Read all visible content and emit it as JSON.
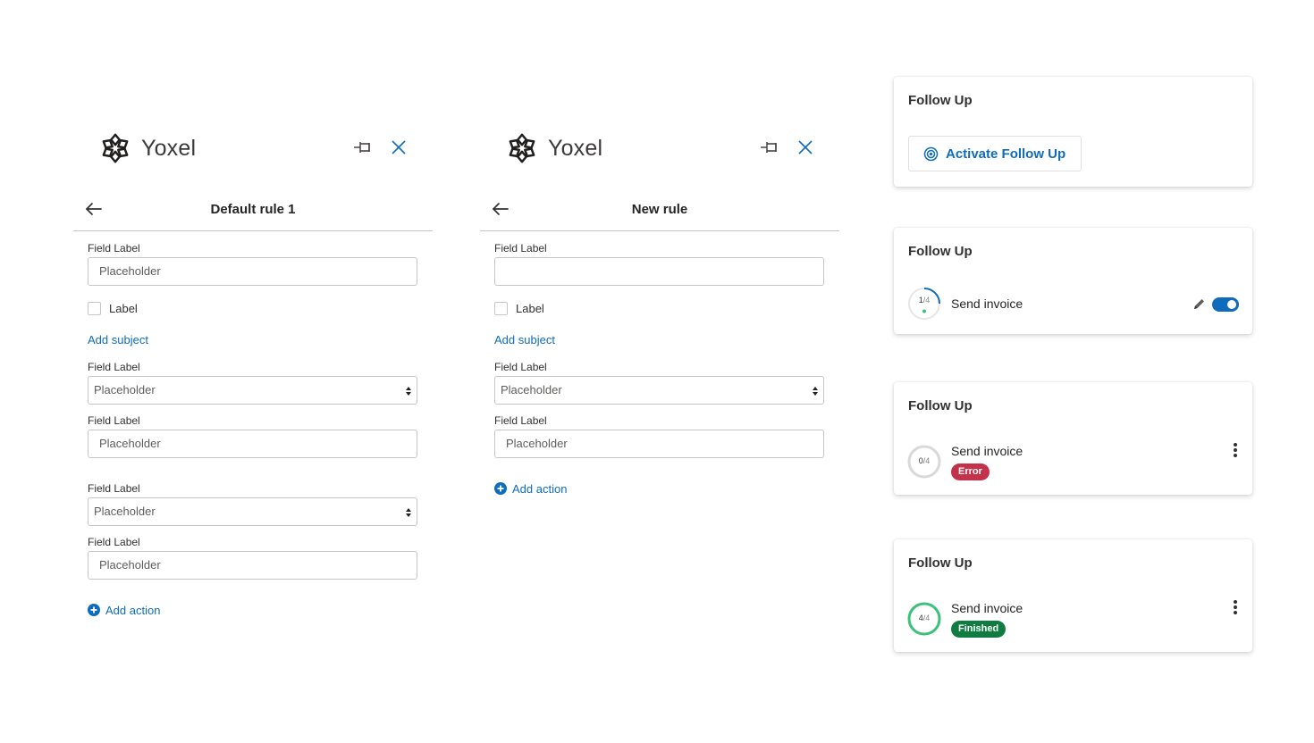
{
  "brand": {
    "name": "Yoxel",
    "logo_icon": "snowflake-logo-icon"
  },
  "rule_panels": [
    {
      "title": "Default rule 1",
      "pin_icon": "pin-icon",
      "close_icon": "close-icon",
      "back_icon": "arrow-left-icon",
      "field1": {
        "label": "Field Label",
        "placeholder": "Placeholder",
        "value": "Placeholder"
      },
      "checkbox": {
        "label": "Label",
        "checked": false
      },
      "add_subject": "Add subject",
      "select1": {
        "label": "Field Label",
        "value": "Placeholder"
      },
      "field2": {
        "label": "Field Label",
        "value": "Placeholder"
      },
      "select2": {
        "label": "Field Label",
        "value": "Placeholder"
      },
      "field3": {
        "label": "Field Label",
        "value": "Placeholder"
      },
      "add_action": "Add action"
    },
    {
      "title": "New rule",
      "pin_icon": "pin-icon",
      "close_icon": "close-icon",
      "back_icon": "arrow-left-icon",
      "field1": {
        "label": "Field Label",
        "value": ""
      },
      "checkbox": {
        "label": "Label",
        "checked": false
      },
      "add_subject": "Add subject",
      "select1": {
        "label": "Field Label",
        "value": "Placeholder"
      },
      "field2": {
        "label": "Field Label",
        "value": "Placeholder"
      },
      "add_action": "Add action"
    }
  ],
  "follow_up_cards": [
    {
      "title": "Follow Up",
      "button": "Activate Follow Up",
      "button_icon": "target-icon"
    },
    {
      "title": "Follow Up",
      "task": "Send invoice",
      "progress_done": "1",
      "progress_sep": "/",
      "progress_total": "4",
      "progress_fraction": 0.25,
      "toggle_on": true,
      "edit_icon": "pencil-icon"
    },
    {
      "title": "Follow Up",
      "task": "Send invoice",
      "progress_done": "0",
      "progress_sep": "/",
      "progress_total": "4",
      "progress_fraction": 0,
      "status": "Error",
      "menu_icon": "more-vertical-icon"
    },
    {
      "title": "Follow Up",
      "task": "Send invoice",
      "progress_done": "4",
      "progress_sep": "/",
      "progress_total": "4",
      "progress_fraction": 1,
      "status": "Finished",
      "menu_icon": "more-vertical-icon"
    }
  ],
  "colors": {
    "accent": "#0f6cbd",
    "error": "#c4314b",
    "success": "#107c41",
    "progress_green": "#3cc179",
    "ring_grey": "#d9d9d9"
  }
}
